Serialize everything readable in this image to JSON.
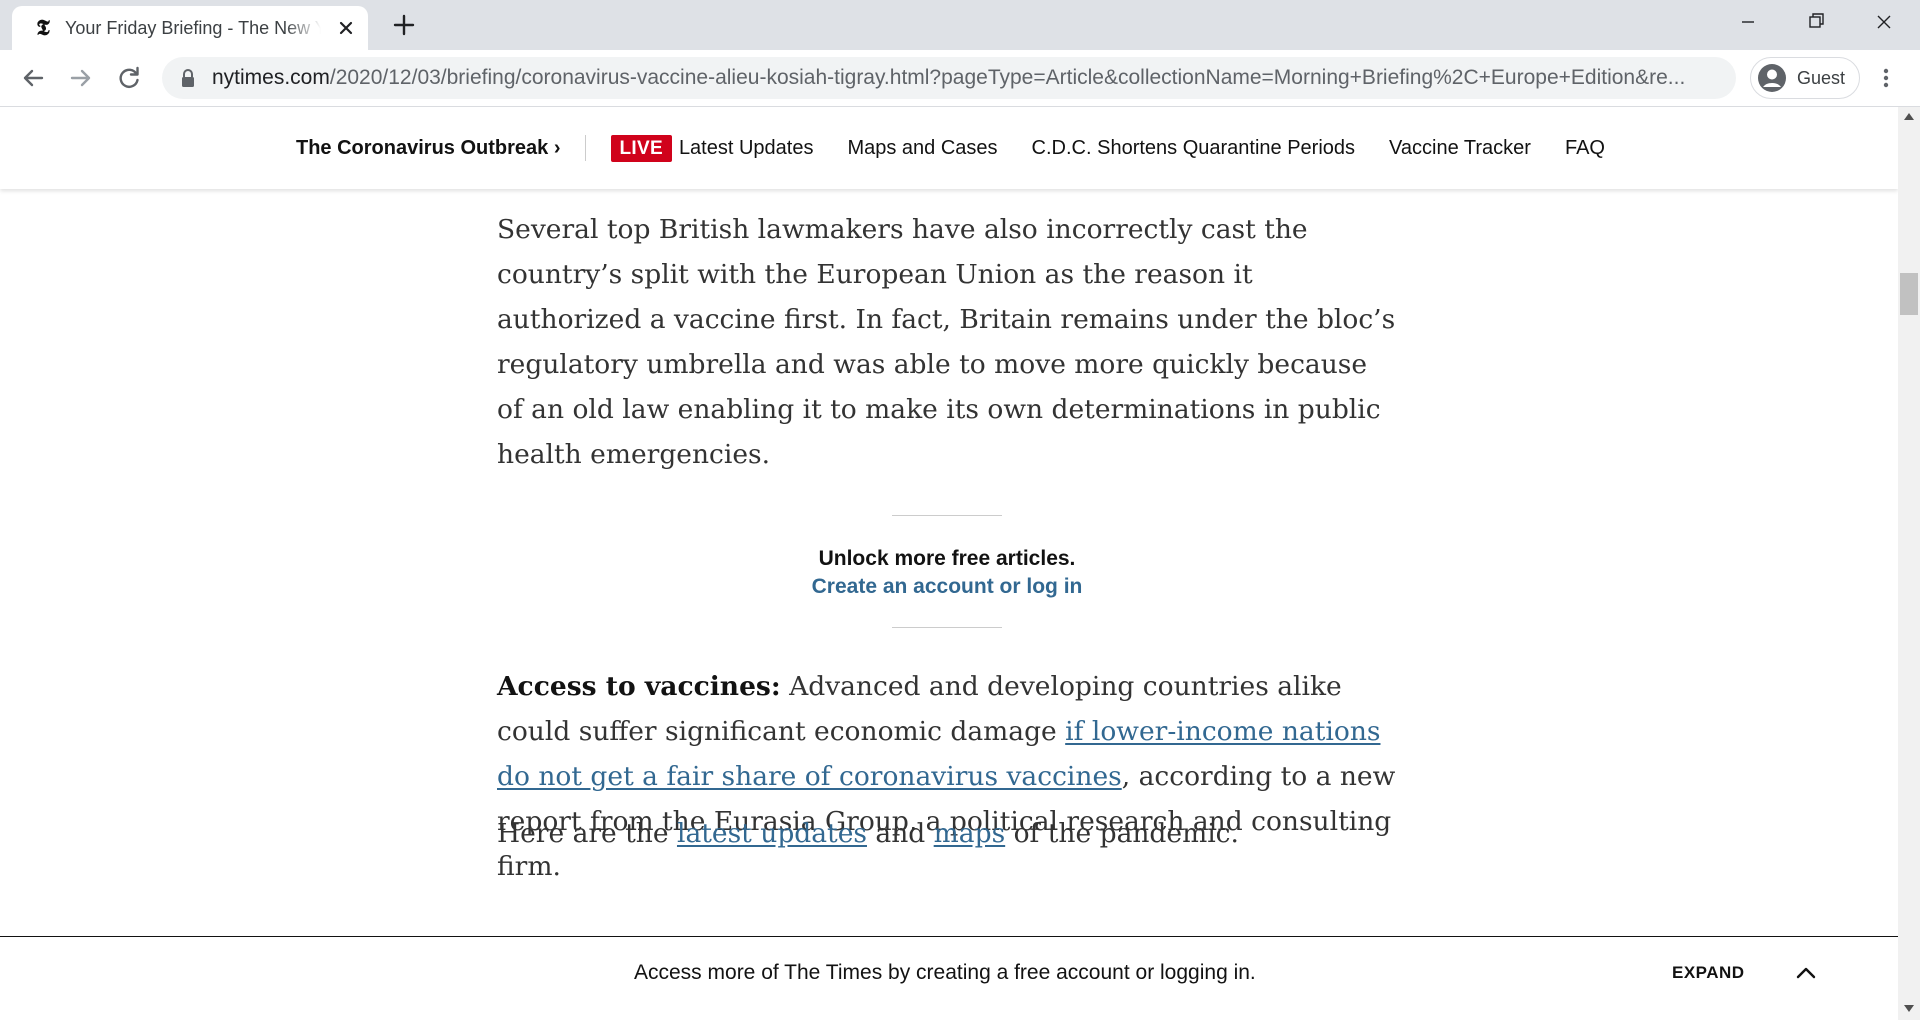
{
  "browser": {
    "tab_title": "Your Friday Briefing - The New York Times",
    "favicon": "𝕿",
    "url_host": "nytimes.com",
    "url_rest": "/2020/12/03/briefing/coronavirus-vaccine-alieu-kosiah-tigray.html?pageType=Article&collectionName=Morning+Briefing%2C+Europe+Edition&re...",
    "profile_name": "Guest"
  },
  "topnav": {
    "section": "The Coronavirus Outbreak ›",
    "live_badge": "LIVE",
    "links": [
      "Latest Updates",
      "Maps and Cases",
      "C.D.C. Shortens Quarantine Periods",
      "Vaccine Tracker",
      "FAQ"
    ]
  },
  "article": {
    "para1": "Several top British lawmakers have also incorrectly cast the country’s split with the European Union as the reason it authorized a vaccine first. In fact, Britain remains under the bloc’s regulatory umbrella and was able to move more quickly because of an old law enabling it to make its own determinations in public health emergencies.",
    "para2_lead": "Access to vaccines:",
    "para2_text1": " Advanced and developing countries alike could suffer significant economic damage ",
    "para2_link": "if lower-income nations do not get a fair share of coronavirus vaccines",
    "para2_text2": ", according to a new report from the Eurasia Group, a political research and consulting firm.",
    "para3_text1": "Here are the ",
    "para3_link1": "latest updates",
    "para3_text2": " and ",
    "para3_link2": "maps",
    "para3_text3": " of the pandemic."
  },
  "unlock": {
    "title": "Unlock more free articles.",
    "link": "Create an account or log in"
  },
  "bottom_bar": {
    "message": "Access more of The Times by creating a free account or logging in.",
    "expand_label": "EXPAND"
  },
  "colors": {
    "live_red": "#d0021b",
    "link_blue": "#326891",
    "chrome_gray": "#dee1e6"
  }
}
